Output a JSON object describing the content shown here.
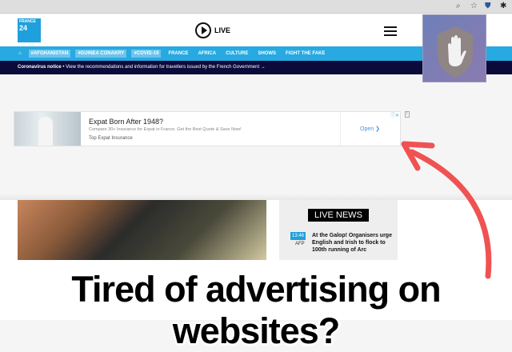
{
  "browser": {
    "icons": [
      "zoom-icon",
      "star-icon",
      "shield-extension-icon",
      "puzzle-icon"
    ]
  },
  "header": {
    "logo_line1": "FRANCE",
    "logo_line2": "24",
    "live_label": "LIVE"
  },
  "nav": {
    "items": [
      "#AFGHANISTAN",
      "#GUINEA CONAKRY",
      "#COVID-19",
      "FRANCE",
      "AFRICA",
      "CULTURE",
      "SHOWS",
      "FIGHT THE FAKE"
    ]
  },
  "notice": {
    "label": "Coronavirus notice",
    "text": " • View the recommendations and information for travellers issued by the French Government →"
  },
  "ad": {
    "title": "Expat Born After 1948?",
    "description": "Compare 30+ Insurance for Expat in France. Get the Best Quote & Save Now!",
    "advertiser": "Top Expat Insurance",
    "cta": "Open ❯"
  },
  "live_news": {
    "title": "LIVE NEWS",
    "time": "13:46",
    "source": "AFP",
    "headline": "At the Galop! Organisers urge English and Irish to flock to 100th running of Arc"
  },
  "caption": "Tired of advertising on websites?",
  "colors": {
    "nav": "#27a9e1",
    "notice": "#0b0b3b",
    "arrow": "#f05252",
    "popup": "#7a7fb5"
  }
}
